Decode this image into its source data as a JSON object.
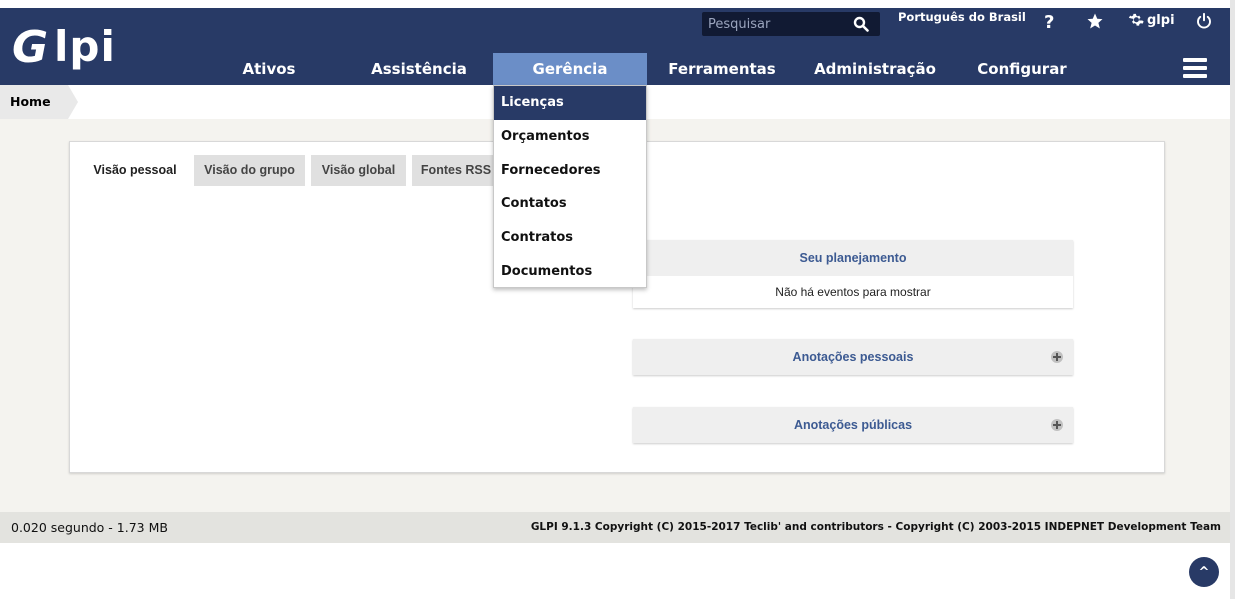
{
  "header": {
    "logo_g": "G",
    "logo_rest": "lpi",
    "search_placeholder": "Pesquisar",
    "language": "Português do Brasil",
    "help_label": "?",
    "username": "glpi"
  },
  "menu": {
    "items": [
      {
        "label": "Ativos"
      },
      {
        "label": "Assistência"
      },
      {
        "label": "Gerência"
      },
      {
        "label": "Ferramentas"
      },
      {
        "label": "Administração"
      },
      {
        "label": "Configurar"
      }
    ],
    "active": "Gerência"
  },
  "dropdown": {
    "items": [
      {
        "label": "Licenças"
      },
      {
        "label": "Orçamentos"
      },
      {
        "label": "Fornecedores"
      },
      {
        "label": "Contatos"
      },
      {
        "label": "Contratos"
      },
      {
        "label": "Documentos"
      }
    ],
    "highlighted": "Licenças"
  },
  "breadcrumb": {
    "home": "Home"
  },
  "tabs": [
    {
      "label": "Visão pessoal"
    },
    {
      "label": "Visão do grupo"
    },
    {
      "label": "Visão global"
    },
    {
      "label": "Fontes RSS"
    }
  ],
  "active_tab": "Visão pessoal",
  "boxes": {
    "planning": {
      "title": "Seu planejamento",
      "body": "Não há eventos para mostrar"
    },
    "personal_notes": {
      "title": "Anotações pessoais"
    },
    "public_notes": {
      "title": "Anotações públicas"
    }
  },
  "footer": {
    "timing": "0.020 segundo - 1.73 MB",
    "copyright": "GLPI 9.1.3 Copyright (C) 2015-2017 Teclib' and contributors - Copyright (C) 2003-2015 INDEPNET Development Team"
  },
  "to_top_label": "^",
  "colors": {
    "header_bg": "#283a66",
    "menu_active_bg": "#6b8ec7",
    "content_bg": "#f4f3ef",
    "box_title": "#3c5a92"
  }
}
